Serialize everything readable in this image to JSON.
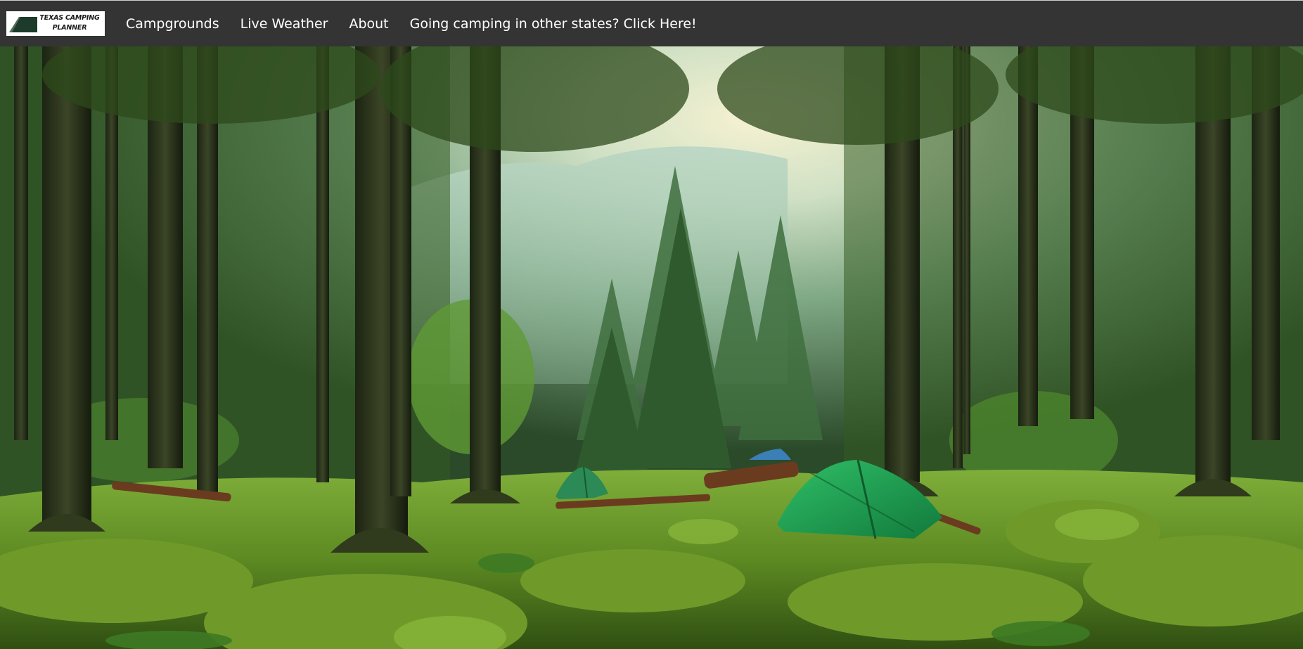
{
  "navbar": {
    "logo": {
      "line1": "TEXAS CAMPING",
      "line2": "PLANNER",
      "icon": "tent-logo-icon"
    },
    "links": [
      {
        "label": "Campgrounds"
      },
      {
        "label": "Live Weather"
      },
      {
        "label": "About"
      },
      {
        "label": "Going camping in other states? Click Here!"
      }
    ]
  },
  "hero": {
    "image": "forest-campsite-image",
    "colors": {
      "navbar_bg": "#343434",
      "sky_glow": "#f3f0d0",
      "moss": "#6f9a2a",
      "tent": "#1f9a50"
    }
  }
}
